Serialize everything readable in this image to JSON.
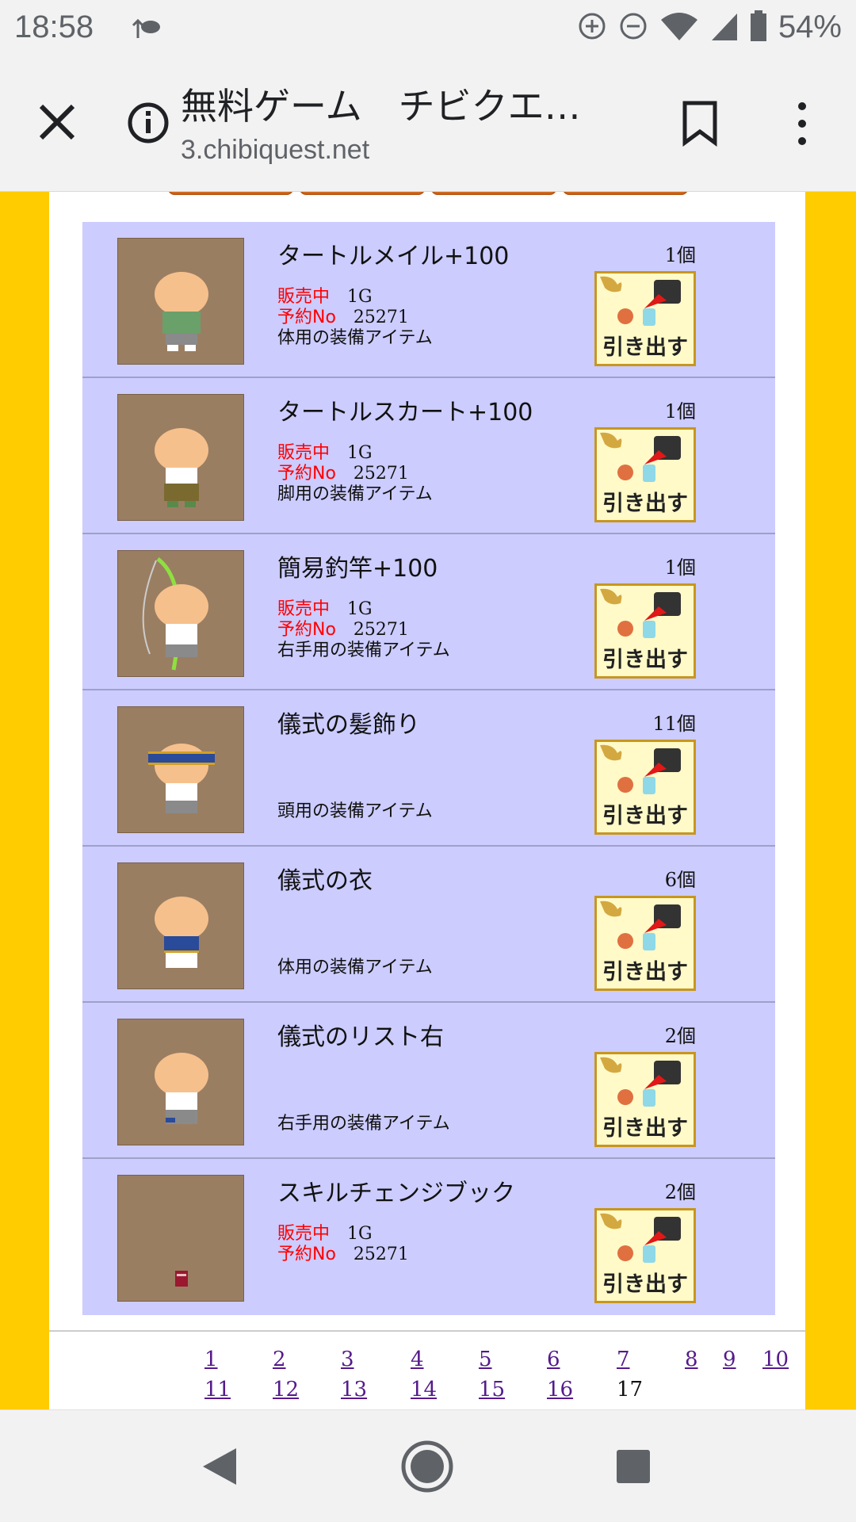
{
  "status_bar": {
    "time": "18:58",
    "battery_percent": "54%",
    "icons": [
      "weather-icon",
      "data-saver-icon",
      "dnd-icon",
      "wifi-icon",
      "signal-icon",
      "battery-icon"
    ]
  },
  "browser": {
    "page_title": "無料ゲーム　チビクエ…",
    "url": "3.chibiquest.net"
  },
  "items": [
    {
      "name": "タートルメイル+100",
      "qty": "1個",
      "sale_label": "販売中",
      "sale_value": "1G",
      "reserve_label": "予約No",
      "reserve_value": "25271",
      "type": "体用の装備アイテム",
      "button": "引き出す"
    },
    {
      "name": "タートルスカート+100",
      "qty": "1個",
      "sale_label": "販売中",
      "sale_value": "1G",
      "reserve_label": "予約No",
      "reserve_value": "25271",
      "type": "脚用の装備アイテム",
      "button": "引き出す"
    },
    {
      "name": "簡易釣竿+100",
      "qty": "1個",
      "sale_label": "販売中",
      "sale_value": "1G",
      "reserve_label": "予約No",
      "reserve_value": "25271",
      "type": "右手用の装備アイテム",
      "button": "引き出す"
    },
    {
      "name": "儀式の髪飾り",
      "qty": "11個",
      "type": "頭用の装備アイテム",
      "button": "引き出す"
    },
    {
      "name": "儀式の衣",
      "qty": "6個",
      "type": "体用の装備アイテム",
      "button": "引き出す"
    },
    {
      "name": "儀式のリスト右",
      "qty": "2個",
      "type": "右手用の装備アイテム",
      "button": "引き出す"
    },
    {
      "name": "スキルチェンジブック",
      "qty": "2個",
      "sale_label": "販売中",
      "sale_value": "1G",
      "reserve_label": "予約No",
      "reserve_value": "25271",
      "button": "引き出す"
    }
  ],
  "pagination": {
    "row1": [
      "1",
      "2",
      "3",
      "4",
      "5",
      "6",
      "7",
      "8",
      "9",
      "10"
    ],
    "row2": [
      "11",
      "12",
      "13",
      "14",
      "15",
      "16"
    ],
    "current": "17"
  },
  "colors": {
    "page_bg": "#ffcc00",
    "row_bg": "#ccccff",
    "sale_red": "#ff0000",
    "link": "#551a8b"
  }
}
